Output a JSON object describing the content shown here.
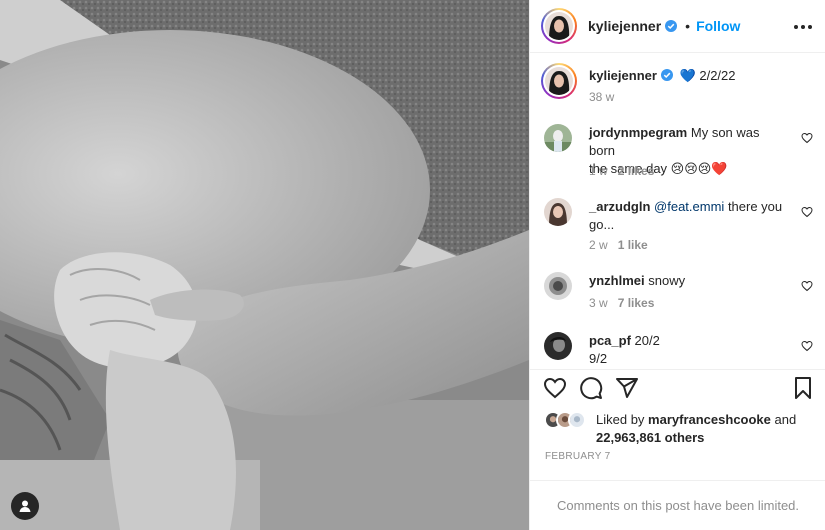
{
  "post": {
    "author": "kyliejenner",
    "follow_label": "Follow",
    "separator": "•"
  },
  "caption": {
    "username": "kyliejenner",
    "text": "💙 2/2/22",
    "age": "38 w"
  },
  "comments": [
    {
      "username": "jordynmpegram",
      "text": "My son was born",
      "text2": "the same day 😢😢😢❤️",
      "age": "1 w",
      "likes": "2 likes"
    },
    {
      "username": "_arzudgln",
      "mention": "@feat.emmi",
      "text": "there you",
      "text2": "go...",
      "age": "2 w",
      "likes": "1 like"
    },
    {
      "username": "ynzhlmei",
      "text": "snowy",
      "age": "3 w",
      "likes": "7 likes"
    },
    {
      "username": "pca_pf",
      "text": "20/2",
      "text2": "9/2"
    }
  ],
  "likes": {
    "prefix": "Liked by",
    "user": "maryfranceshcooke",
    "and": "and",
    "count": "22,963,861 others"
  },
  "date": "FEBRUARY 7",
  "comments_limited": "Comments on this post have been limited.",
  "colors": {
    "accent": "#0095f6",
    "verified": "#3897f0",
    "muted": "#8e8e8e",
    "heart_emoji": "#e0245e"
  },
  "icons": [
    "user-tag-icon",
    "verified-icon",
    "more-options-icon",
    "heart-icon",
    "comment-icon",
    "share-icon",
    "bookmark-icon"
  ]
}
